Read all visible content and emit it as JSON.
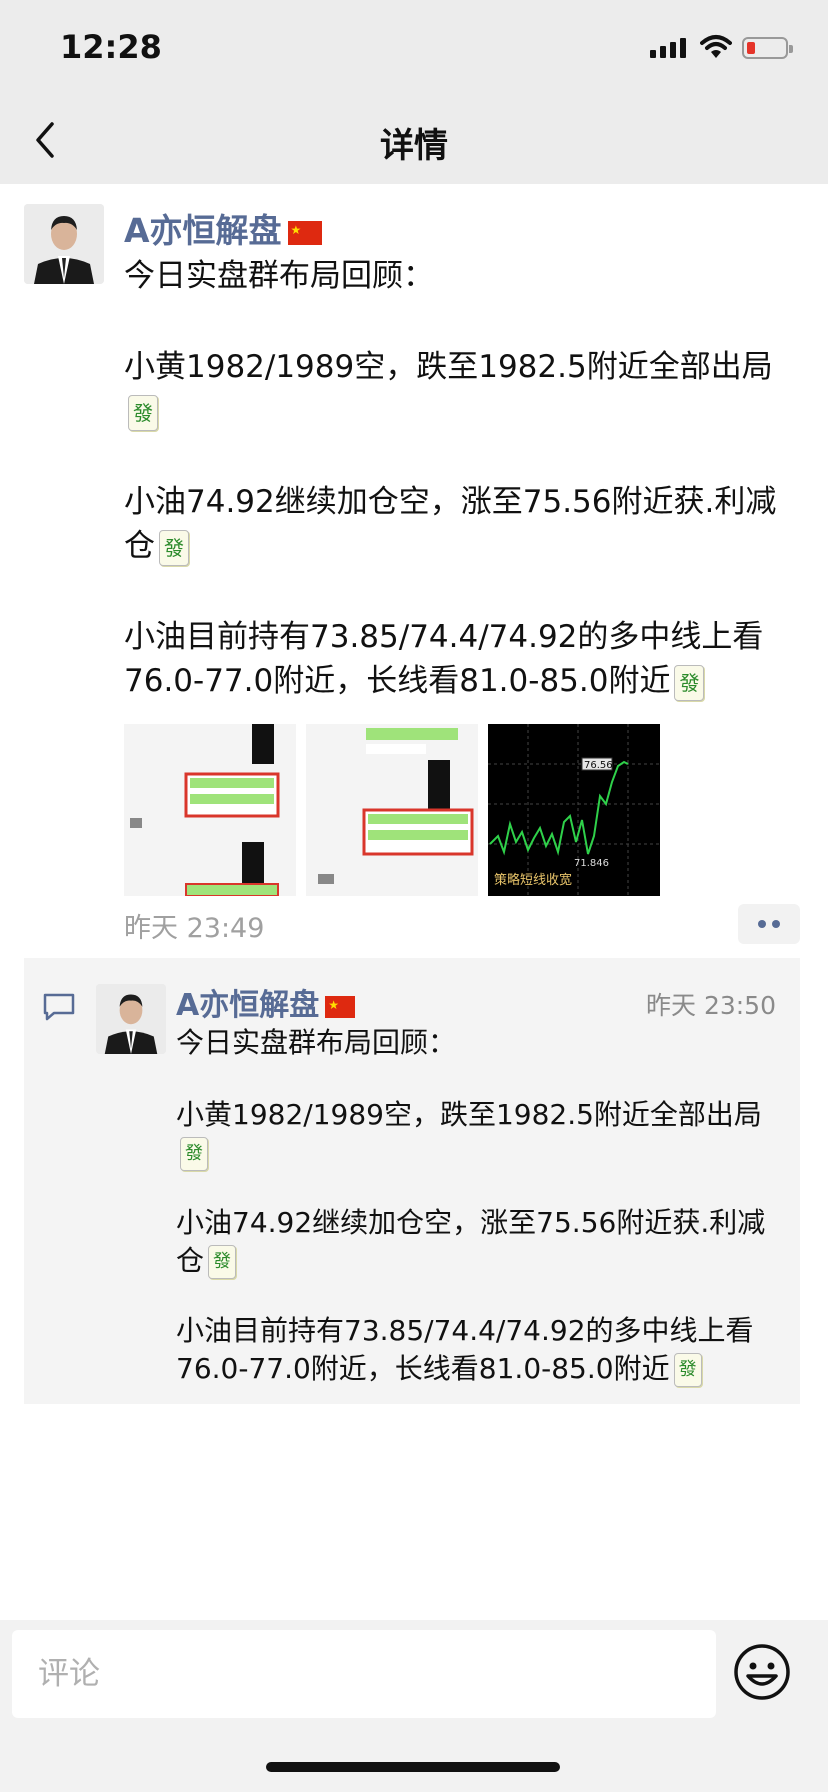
{
  "status": {
    "time": "12:28"
  },
  "nav": {
    "title": "详情"
  },
  "post": {
    "author": "A亦恒解盘",
    "paragraphs": [
      "今日实盘群布局回顾：",
      "小黄1982/1989空，跌至1982.5附近全部出局",
      "小油74.92继续加仓空，涨至75.56附近获.利减仓",
      "小油目前持有73.85/74.4/74.92的多中线上看76.0-77.0附近，长线看81.0-85.0附近"
    ],
    "fa_emoji": "發",
    "images": [
      "chat-screenshot-1",
      "chat-screenshot-2",
      "price-chart"
    ],
    "chart_labels": {
      "top": "76.56",
      "bottom": "71.846",
      "caption": "策略短线收宽"
    },
    "timestamp": "昨天 23:49"
  },
  "comment": {
    "author": "A亦恒解盘",
    "timestamp": "昨天 23:50",
    "paragraphs": [
      "今日实盘群布局回顾：",
      "小黄1982/1989空，跌至1982.5附近全部出局",
      "小油74.92继续加仓空，涨至75.56附近获.利减仓",
      "小油目前持有73.85/74.4/74.92的多中线上看76.0-77.0附近，长线看81.0-85.0附近"
    ]
  },
  "input": {
    "placeholder": "评论"
  },
  "colors": {
    "name": "#576b95",
    "navbar": "#ececec",
    "timestamp": "#a0a0a0"
  },
  "icons": [
    "back-chevron-icon",
    "comment-bubble-icon",
    "emoji-icon",
    "more-dots-icon",
    "china-flag-icon"
  ]
}
